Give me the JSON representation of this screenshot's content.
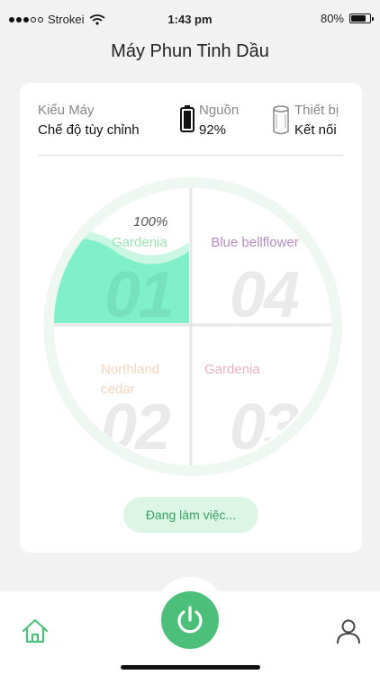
{
  "status_bar": {
    "carrier": "Strokei",
    "time": "1:43 pm",
    "battery_text": "80%",
    "battery_level": 0.8
  },
  "title": "Máy Phun Tinh Dầu",
  "info": {
    "type_label": "Kiểu Máy",
    "type_value": "Chế độ tùy chỉnh",
    "power_label": "Nguồn",
    "power_value": "92%",
    "device_label": "Thiết bị",
    "device_value": "Kết nối"
  },
  "dial": {
    "quadrants": [
      {
        "number": "01",
        "name": "Gardenia",
        "level": "100%",
        "color": "#7ff0c9"
      },
      {
        "number": "04",
        "name": "Blue bellflower",
        "color": "#b58cc4"
      },
      {
        "number": "02",
        "name": "Northland cedar",
        "color": "#f2d5bd"
      },
      {
        "number": "03",
        "name": "Gardenia",
        "color": "#eab2c5"
      }
    ]
  },
  "status_button": "Đang làm việc...",
  "icons": {
    "home": "home-icon",
    "power": "power-icon",
    "profile": "user-icon"
  },
  "colors": {
    "accent": "#4cc07a",
    "fill": "#7ff0c9"
  }
}
